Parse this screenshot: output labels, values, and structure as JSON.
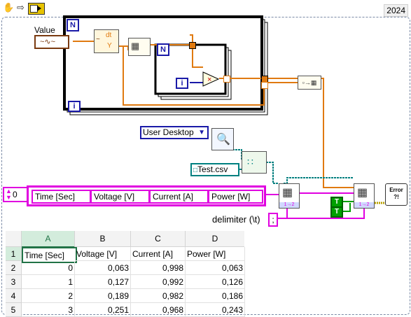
{
  "toolbar": {
    "icons": [
      "hand-icon",
      "run-arrow-icon",
      "labview-run-icon"
    ],
    "year": "2024"
  },
  "diagram": {
    "value_label": "Value",
    "loop_n_outer": "N",
    "loop_n_inner": "N",
    "loop_i_outer": "i",
    "loop_i_inner": "i",
    "dt_label": "dt",
    "y_label": "Y",
    "path_dropdown": "User Desktop",
    "file_name": "Test.csv",
    "array_index": "0",
    "header_cells": [
      "Time [Sec]",
      "Voltage [V]",
      "Current [A]",
      "Power [W]"
    ],
    "delimiter_label": "delimiter (\\t)",
    "delimiter_value": ";",
    "bool_true_1": "T",
    "bool_true_2": "T",
    "error_label": "Error ?!",
    "colors": {
      "orange_wire": "#e07a10",
      "pink_wire": "#e000e0",
      "green_wire": "#00a000",
      "teal_wire": "#008080",
      "loop_border": "#000000",
      "control_blue": "#1a1aa8"
    }
  },
  "spreadsheet": {
    "columns": [
      "A",
      "B",
      "C",
      "D"
    ],
    "rows": [
      {
        "num": "1",
        "cells": [
          "Time [Sec]",
          "Voltage [V]",
          "Current [A]",
          "Power [W]"
        ]
      },
      {
        "num": "2",
        "cells": [
          "0",
          "0,063",
          "0,998",
          "0,063"
        ]
      },
      {
        "num": "3",
        "cells": [
          "1",
          "0,127",
          "0,992",
          "0,126"
        ]
      },
      {
        "num": "4",
        "cells": [
          "2",
          "0,189",
          "0,982",
          "0,186"
        ]
      },
      {
        "num": "5",
        "cells": [
          "3",
          "0,251",
          "0,968",
          "0,243"
        ]
      }
    ]
  }
}
